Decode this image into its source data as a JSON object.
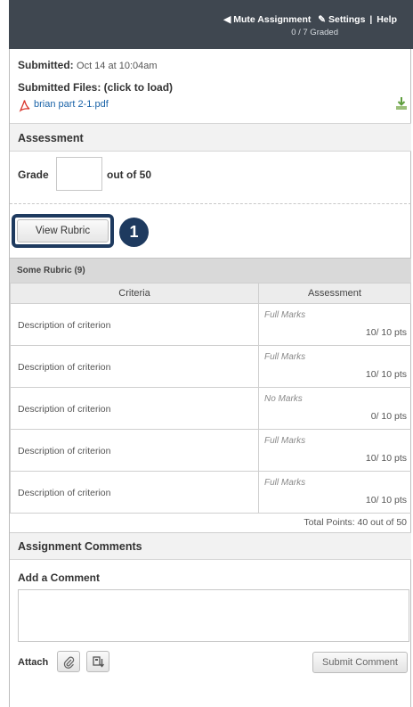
{
  "header": {
    "mute_label": "◀ Mute Assignment",
    "settings_label": "✎ Settings",
    "separator": "|",
    "help_label": "Help",
    "graded_status": "0 / 7 Graded",
    "background_color": "#3f4750"
  },
  "submission": {
    "submitted_label": "Submitted:",
    "submitted_date": "Oct 14 at 10:04am",
    "files_label": "Submitted Files: (click to load)",
    "file_name": "brian part 2-1.pdf",
    "file_icon": "pdf-icon",
    "download_icon": "download-icon"
  },
  "assessment": {
    "title": "Assessment",
    "grade_label": "Grade",
    "grade_value": "",
    "out_of": "out of 50",
    "view_rubric_label": "View Rubric",
    "step_number": "1",
    "highlight_color": "#1e3a5f"
  },
  "rubric": {
    "name": "Some Rubric (9)",
    "columns": [
      "Criteria",
      "Assessment"
    ],
    "rows": [
      {
        "criterion": "Description of criterion",
        "rating": "Full Marks",
        "points": "10/ 10 pts"
      },
      {
        "criterion": "Description of criterion",
        "rating": "Full Marks",
        "points": "10/ 10 pts"
      },
      {
        "criterion": "Description of criterion",
        "rating": "No Marks",
        "points": "0/ 10 pts"
      },
      {
        "criterion": "Description of criterion",
        "rating": "Full Marks",
        "points": "10/ 10 pts"
      },
      {
        "criterion": "Description of criterion",
        "rating": "Full Marks",
        "points": "10/ 10 pts"
      }
    ],
    "total": "Total Points: 40 out of 50"
  },
  "comments": {
    "title": "Assignment Comments",
    "add_label": "Add a Comment",
    "comment_value": "",
    "attach_label": "Attach",
    "attach_file_icon": "paperclip-icon",
    "attach_media_icon": "media-icon",
    "submit_label": "Submit Comment"
  }
}
